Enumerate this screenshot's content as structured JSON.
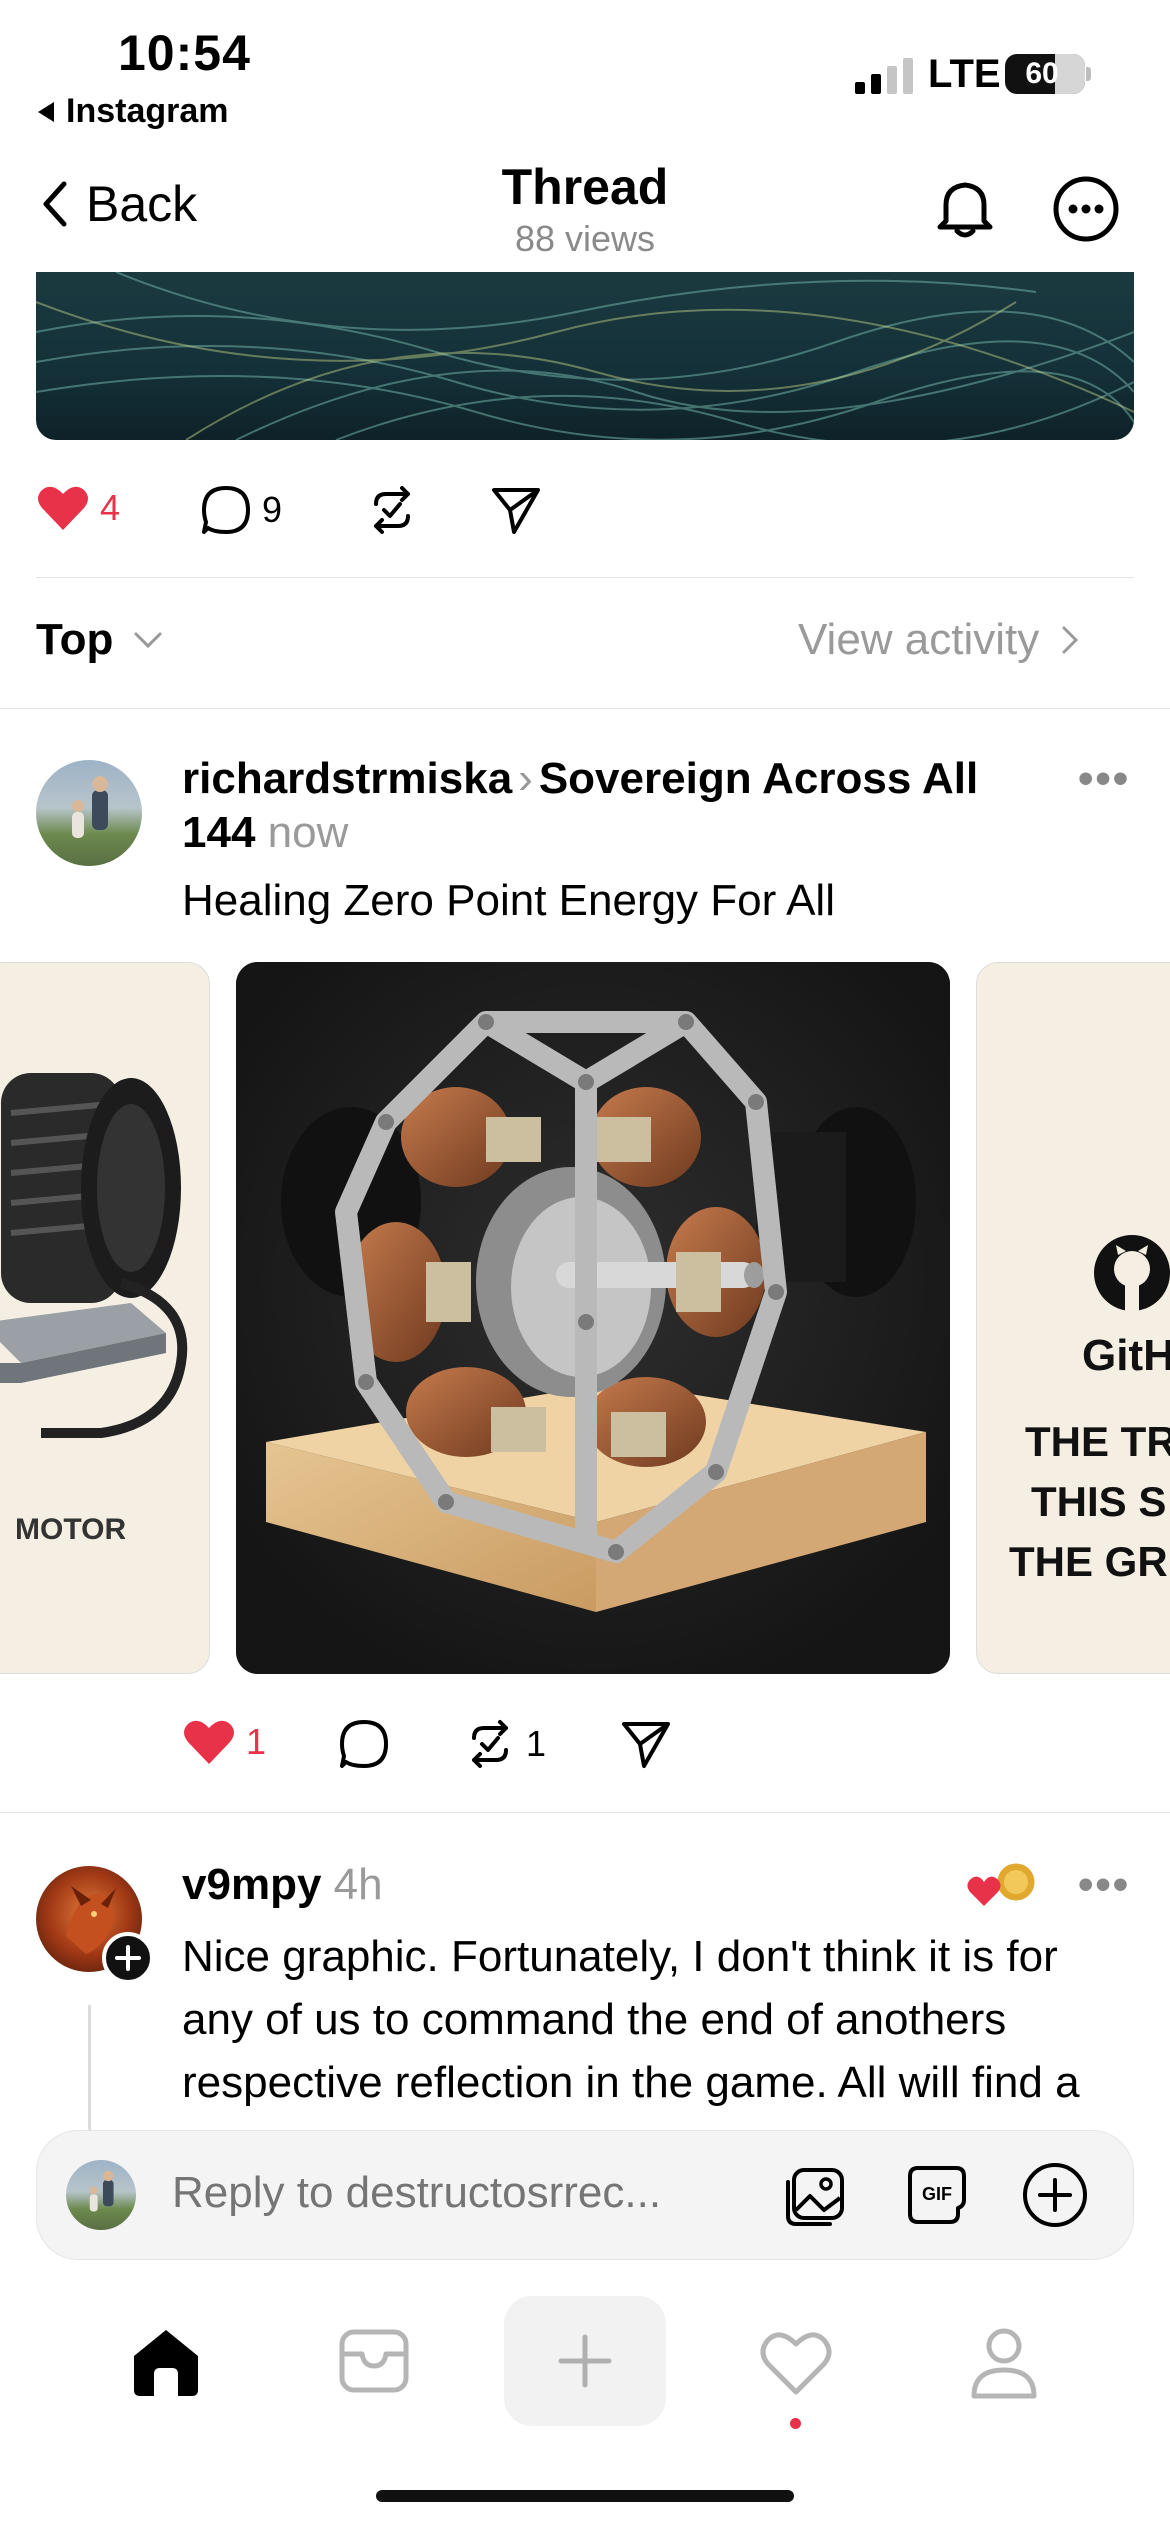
{
  "status_bar": {
    "time": "10:54",
    "back_app": "Instagram",
    "network": "LTE",
    "battery": "60"
  },
  "header": {
    "back_label": "Back",
    "title": "Thread",
    "views": "88 views"
  },
  "main_post_actions": {
    "likes": "4",
    "comments": "9"
  },
  "sort": {
    "label": "Top",
    "view_activity": "View activity"
  },
  "post": {
    "author": "richardstrmiska",
    "community": "Sovereign Across All 144",
    "time": "now",
    "text": "Healing Zero Point Energy For All",
    "left_card_label": "MOTOR",
    "right_card_brand": "GitH",
    "right_card_lines": [
      "THE TR",
      "THIS S",
      "THE GR"
    ],
    "likes": "1",
    "reposts": "1"
  },
  "reply": {
    "author": "v9mpy",
    "time": "4h",
    "text": "Nice graphic. Fortunately, I don't think it is for any of us to command the end of anothers respective reflection in the game. All will find a way to get. Or reproduction."
  },
  "composer": {
    "placeholder": "Reply to destructosrrec..."
  },
  "colors": {
    "like_red": "#e8324a",
    "muted": "#9a9a9a"
  }
}
